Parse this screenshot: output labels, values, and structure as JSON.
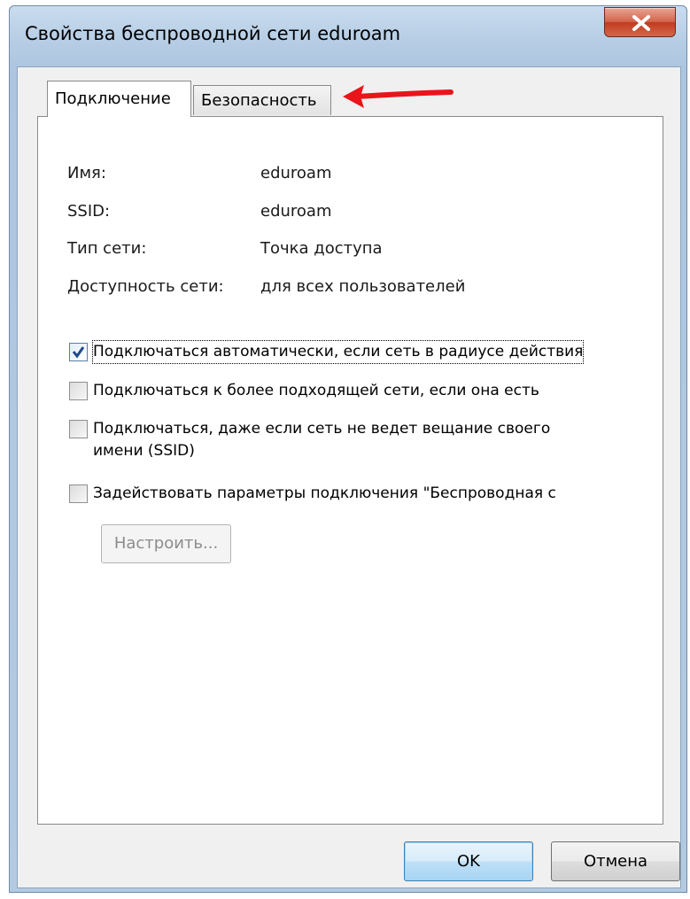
{
  "window": {
    "title": "Свойства беспроводной сети eduroam"
  },
  "tabs": [
    {
      "label": "Подключение",
      "active": true
    },
    {
      "label": "Безопасность",
      "active": false
    }
  ],
  "info": [
    {
      "key": "Имя:",
      "value": "eduroam"
    },
    {
      "key": "SSID:",
      "value": "eduroam"
    },
    {
      "key": "Тип сети:",
      "value": "Точка доступа"
    },
    {
      "key": "Доступность сети:",
      "value": "для всех пользователей"
    }
  ],
  "options": [
    {
      "label": "Подключаться автоматически, если сеть в радиусе действия",
      "checked": true
    },
    {
      "label": "Подключаться к более подходящей сети, если она есть",
      "checked": false
    },
    {
      "label_line1": "Подключаться, даже если сеть не ведет вещание своего",
      "label_line2": "имени (SSID)",
      "checked": false
    },
    {
      "label": "Задействовать параметры подключения \"Беспроводная с",
      "checked": false
    }
  ],
  "configure_button": "Настроить...",
  "buttons": {
    "ok": "OK",
    "cancel": "Отмена"
  },
  "colors": {
    "arrow": "#e8151b",
    "close_button": "#c94a2e",
    "ok_border": "#3c7fb1"
  }
}
